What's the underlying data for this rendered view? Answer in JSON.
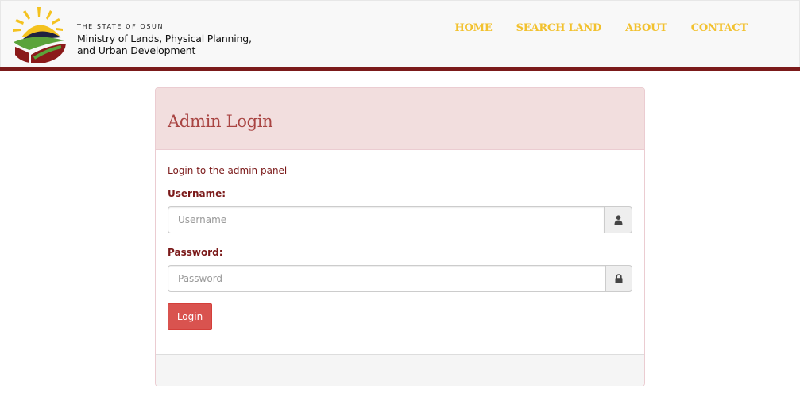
{
  "header": {
    "state_label": "THE STATE OF OSUN",
    "ministry_line1": "Ministry of Lands, Physical Planning,",
    "ministry_line2": "and Urban Development",
    "logo_icon": "osun-sunrise-logo",
    "nav": [
      {
        "label": "HOME"
      },
      {
        "label": "SEARCH LAND"
      },
      {
        "label": "ABOUT"
      },
      {
        "label": "CONTACT"
      }
    ],
    "colors": {
      "accent_bar": "#7b1a1a",
      "nav_link": "#f2c12e"
    }
  },
  "login": {
    "title": "Admin Login",
    "intro": "Login to the admin panel",
    "username_label": "Username:",
    "username_placeholder": "Username",
    "username_value": "",
    "username_icon": "user-icon",
    "password_label": "Password:",
    "password_placeholder": "Password",
    "password_value": "",
    "password_icon": "lock-icon",
    "submit_label": "Login",
    "colors": {
      "heading_bg": "#f2dede",
      "title_text": "#a94442",
      "button": "#d9534f"
    }
  }
}
